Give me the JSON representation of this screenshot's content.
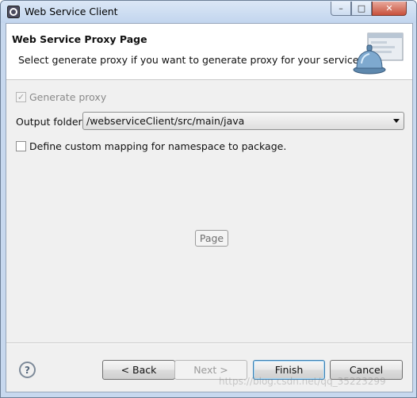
{
  "window": {
    "title": "Web Service Client",
    "controls": {
      "minimize": "–",
      "maximize": "□",
      "close": "✕"
    }
  },
  "banner": {
    "title": "Web Service Proxy Page",
    "description": "Select generate proxy if you want to generate proxy for your service.",
    "icon": "web-service-bell-icon"
  },
  "form": {
    "generate_proxy_label": "Generate proxy",
    "generate_proxy_checked": true,
    "output_folder_label": "Output folder",
    "output_folder_value": "/webserviceClient/src/main/java",
    "custom_mapping_label": "Define custom mapping for namespace to package.",
    "custom_mapping_checked": false,
    "page_button": "Page"
  },
  "footer": {
    "help": "?",
    "back": "< Back",
    "next": "Next >",
    "finish": "Finish",
    "cancel": "Cancel"
  },
  "watermark": "https://blog.csdn.net/qq_35223299"
}
